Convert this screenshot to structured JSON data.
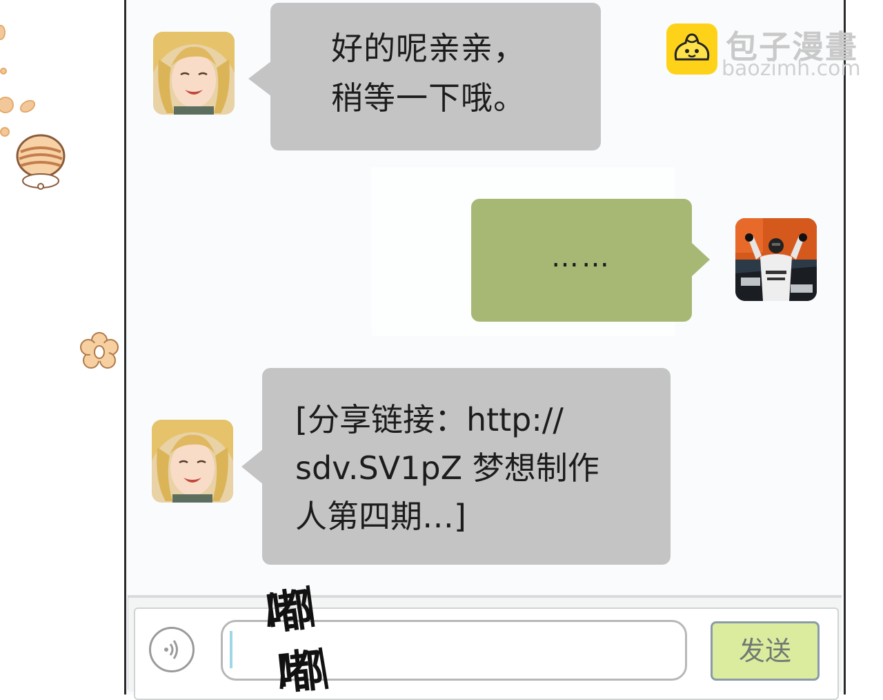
{
  "watermark": {
    "title": "包子漫畫",
    "url": "baozimh.com"
  },
  "messages": [
    {
      "sender": "other",
      "lines": [
        "好的呢亲亲，",
        "稍等一下哦。"
      ]
    },
    {
      "sender": "self",
      "text": "……"
    },
    {
      "sender": "other",
      "lines": [
        "[分享链接：http://",
        "sdv.SV1pZ 梦想制作",
        "人第四期…]"
      ]
    }
  ],
  "input_bar": {
    "text_value": "",
    "send_label": "发送"
  },
  "sound_effect": "嘟嘟",
  "colors": {
    "bubble_gray": "#c4c4c4",
    "bubble_green": "#a7b874",
    "send_button": "#dcec9e",
    "chat_background": "#f9fbfd"
  }
}
